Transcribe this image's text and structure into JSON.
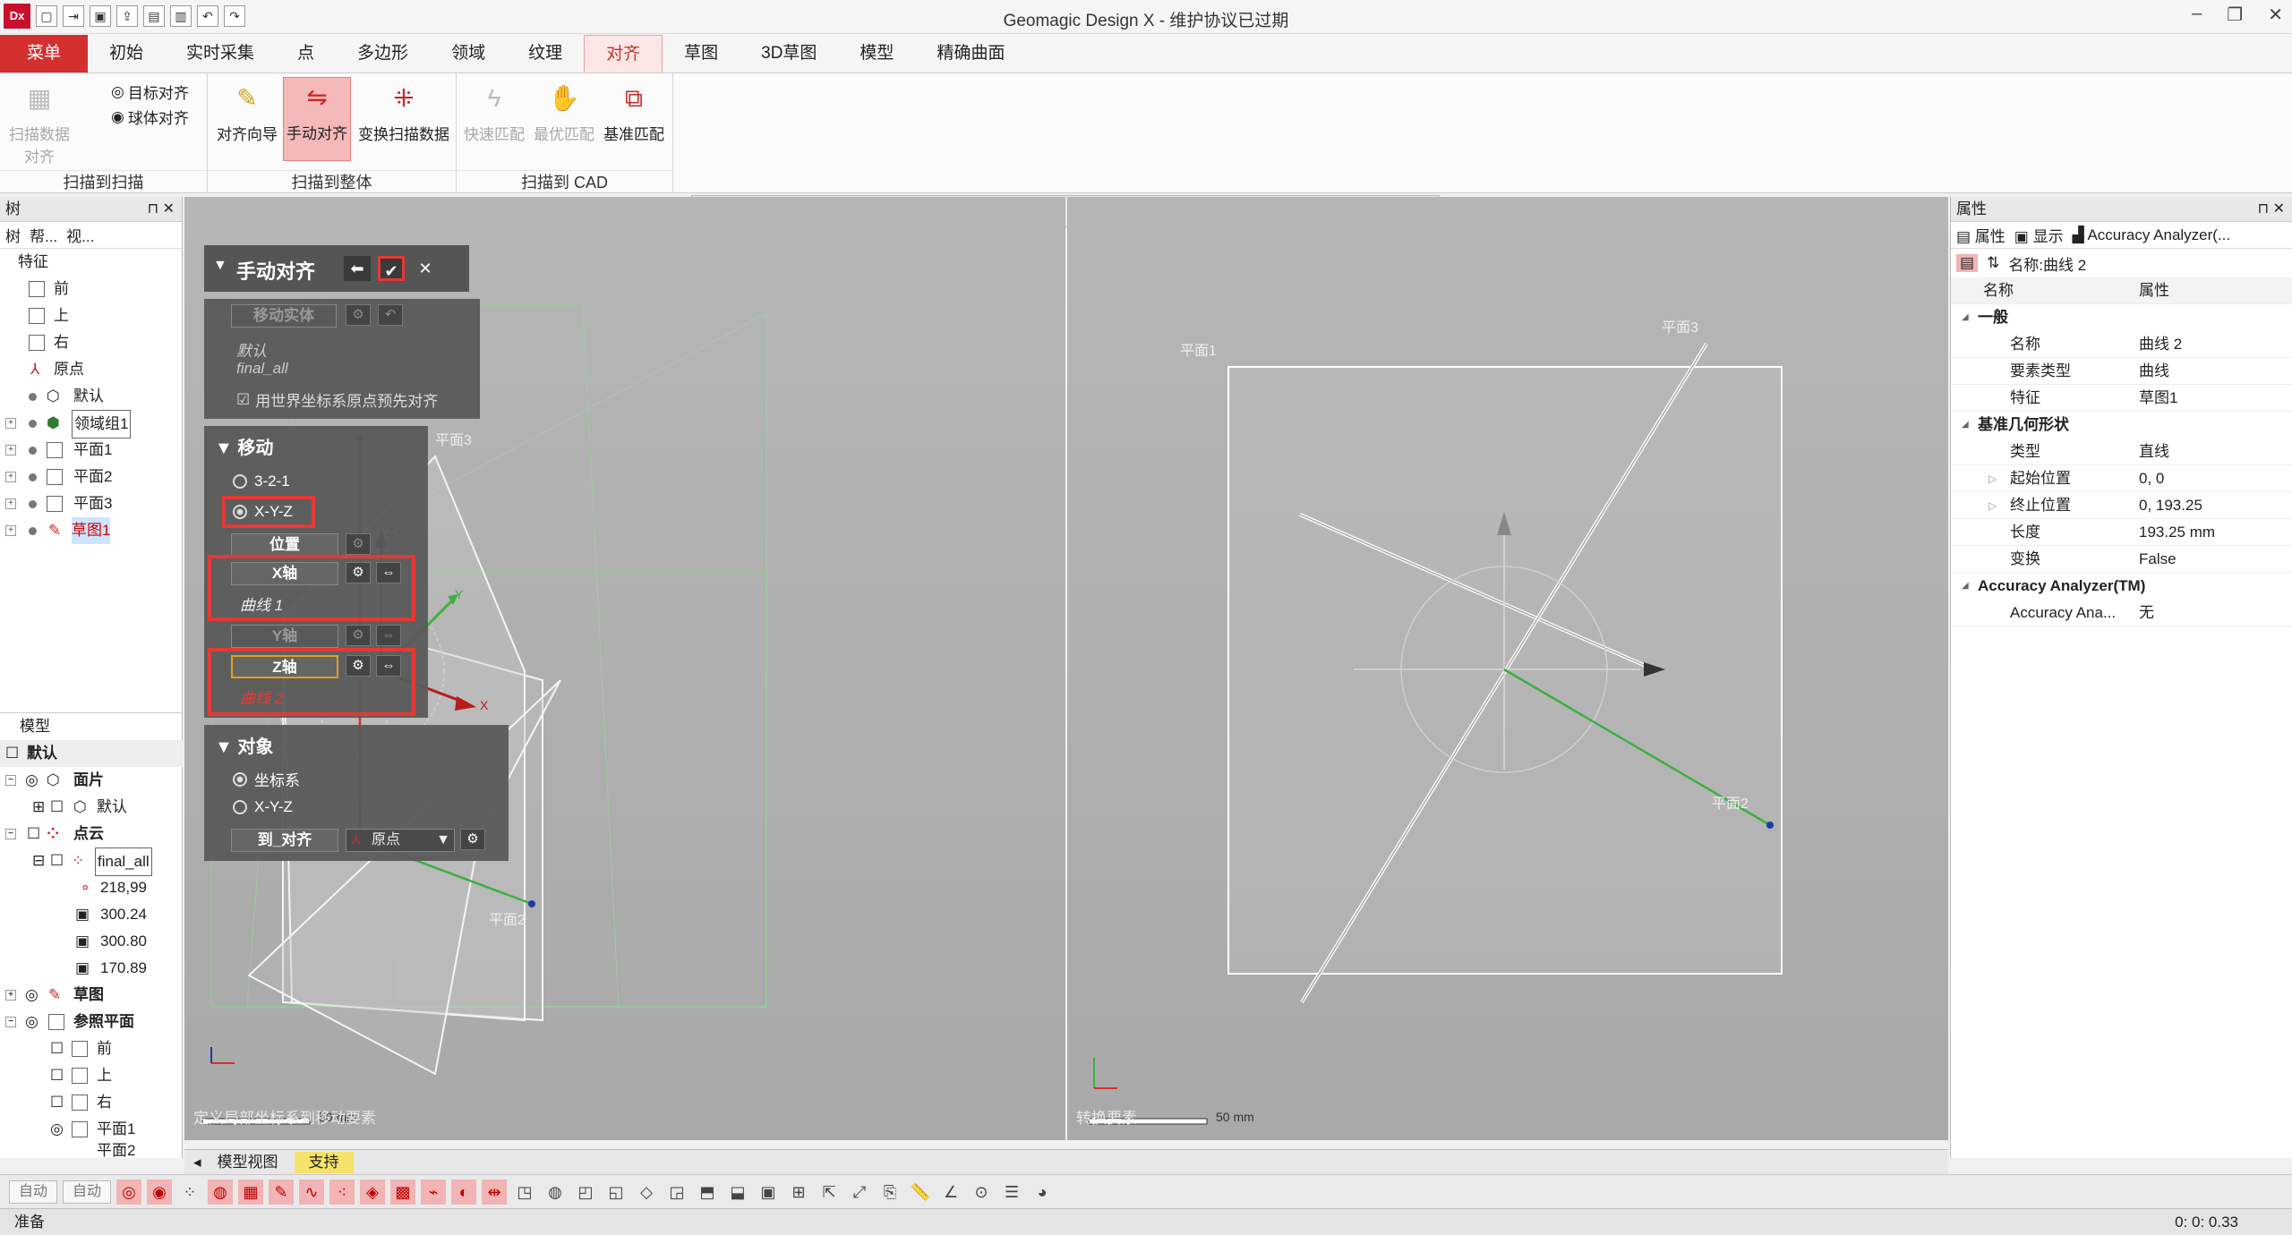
{
  "app": {
    "logo": "Dx",
    "title": "Geomagic Design X - 维护协议已过期"
  },
  "tabs": [
    "菜单",
    "初始",
    "实时采集",
    "点",
    "多边形",
    "领域",
    "纹理",
    "对齐",
    "草图",
    "3D草图",
    "模型",
    "精确曲面"
  ],
  "ribbon": {
    "group1": {
      "label": "扫描到扫描",
      "scan_align": "扫描数据对齐",
      "target_align": "目标对齐",
      "sphere_align": "球体对齐"
    },
    "group2": {
      "label": "扫描到整体",
      "align_wizard": "对齐向导",
      "manual_align": "手动对齐",
      "transform_scan": "变换扫描数据"
    },
    "group3": {
      "label": "扫描到 CAD",
      "quick_fit": "快速匹配",
      "best_fit": "最优匹配",
      "datum_fit": "基准匹配"
    }
  },
  "left_panel": {
    "title": "树",
    "subtabs": [
      "树",
      "帮...",
      "视..."
    ],
    "feature_header": "特征",
    "features": [
      "前",
      "上",
      "右",
      "原点",
      "默认",
      "领域组1",
      "平面1",
      "平面2",
      "平面3",
      "草图1"
    ],
    "model_header": "模型",
    "model_items": {
      "default": "默认",
      "mesh": "面片",
      "mesh_default": "默认",
      "point_cloud": "点云",
      "final_all": "final_all",
      "v1": "218,99",
      "v2": "300.24",
      "v3": "300.80",
      "v4": "170.89",
      "sketch": "草图",
      "ref_plane": "参照平面",
      "front": "前",
      "top": "上",
      "right": "右",
      "plane1": "平面1",
      "plane_more": "平面2"
    }
  },
  "manual_align": {
    "title": "手动对齐",
    "move_entity": "移动实体",
    "default_text": "默认",
    "final_all": "final_all",
    "checkbox": "用世界坐标系原点预先对齐",
    "move_header": "移动",
    "opt_321": "3-2-1",
    "opt_xyz": "X-Y-Z",
    "position": "位置",
    "x_axis": "X轴",
    "curve1": "曲线 1",
    "y_axis": "Y轴",
    "z_axis": "Z轴",
    "curve2": "曲线 2",
    "target_header": "对象",
    "coord_sys": "坐标系",
    "opt_xyz2": "X-Y-Z",
    "to_align": "到_对齐",
    "origin": "原点"
  },
  "viewport_left": {
    "plane3": "平面3",
    "plane2": "平面2",
    "scale": "50 mm",
    "caption": "定义局部坐标系到移动要素",
    "axis_x": "X",
    "axis_y": "Y",
    "axis_z": "Z"
  },
  "viewport_right": {
    "plane1": "平面1",
    "plane3": "平面3",
    "plane2": "平面2",
    "scale": "50 mm",
    "caption": "转换要素"
  },
  "right_panel": {
    "title": "属性",
    "subtabs": [
      "属性",
      "显示",
      "Accuracy Analyzer(..."
    ],
    "name_label": "名称:曲线 2",
    "col_name": "名称",
    "col_prop": "属性",
    "cat_general": "一般",
    "rows_general": [
      {
        "k": "名称",
        "v": "曲线 2"
      },
      {
        "k": "要素类型",
        "v": "曲线"
      },
      {
        "k": "特征",
        "v": "草图1"
      }
    ],
    "cat_geom": "基准几何形状",
    "rows_geom": [
      {
        "k": "类型",
        "v": "直线"
      },
      {
        "k": "起始位置",
        "v": "0, 0"
      },
      {
        "k": "终止位置",
        "v": "0, 193.25"
      },
      {
        "k": "长度",
        "v": "193.25 mm"
      },
      {
        "k": "变换",
        "v": "False"
      }
    ],
    "cat_accuracy": "Accuracy Analyzer(TM)",
    "rows_accuracy": [
      {
        "k": "Accuracy Ana...",
        "v": "无"
      }
    ]
  },
  "view_tabs": [
    "模型视图",
    "支持"
  ],
  "bottom": {
    "drop1": "自动",
    "drop2": "自动"
  },
  "status": {
    "left": "准备",
    "time": "0: 0: 0.33"
  },
  "colors": {
    "accent": "#d32f2f",
    "viewport_bg": "#b0b0b0",
    "panel_dark": "#555555"
  }
}
